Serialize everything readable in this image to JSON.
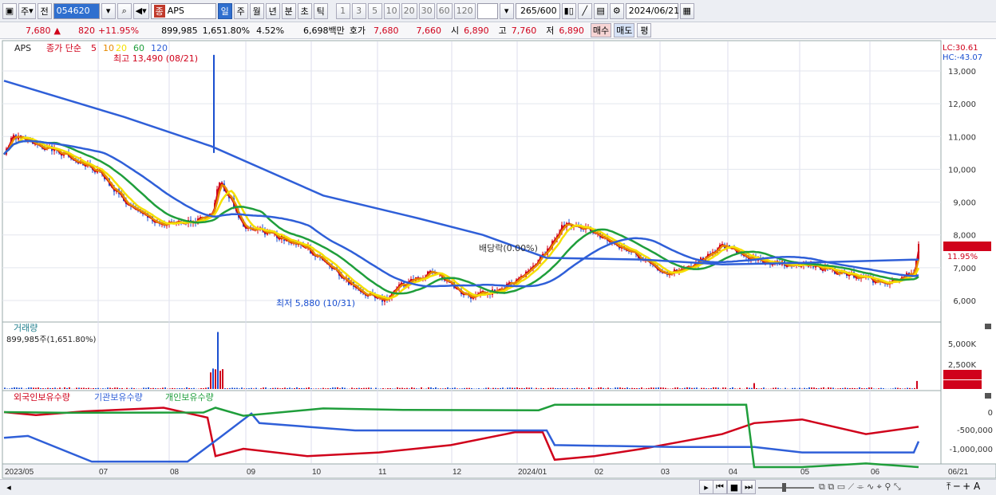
{
  "toolbar": {
    "market": "주",
    "prev": "전",
    "code": "054620",
    "stock_name": "APS",
    "hts": "종",
    "periods": [
      "일",
      "주",
      "월",
      "년",
      "분",
      "초",
      "틱"
    ],
    "active_period": "일",
    "counts": [
      "1",
      "3",
      "5",
      "10",
      "20",
      "30",
      "60",
      "120"
    ],
    "page": "265",
    "page_total": "/600",
    "date": "2024/06/21"
  },
  "quote": {
    "price": "7,680",
    "change": "820",
    "change_pct": "+11.95%",
    "volume": "899,985",
    "volume_pct": "1,651.80%",
    "turnover": "4.52%",
    "amount": "6,698백만",
    "bid_label": "호가",
    "ask": "7,680",
    "bid": "7,660",
    "open_label": "시",
    "open": "6,890",
    "high_label": "고",
    "high": "7,760",
    "low_label": "저",
    "low": "6,890",
    "buy": "매수",
    "sell": "매도",
    "avg": "평"
  },
  "price_panel": {
    "name": "APS",
    "legend_prefix": "종가 단순",
    "ma": [
      {
        "period": "5",
        "color": "#d0021b"
      },
      {
        "period": "10",
        "color": "#e68a00"
      },
      {
        "period": "20",
        "color": "#f5e000"
      },
      {
        "period": "60",
        "color": "#1f9e3b"
      },
      {
        "period": "120",
        "color": "#2f5fd8"
      }
    ],
    "lc": "LC:30.61",
    "hc": "HC:-43.07",
    "high_note": "최고 13,490 (08/21)",
    "low_note": "최저 5,880 (10/31)",
    "dividend": "배당락(0.00%)",
    "price_tag": "7,680",
    "pct_tag": "11.95%",
    "y_ticks": [
      "13,000",
      "12,000",
      "11,000",
      "10,000",
      "9,000",
      "8,000",
      "7,000",
      "6,000"
    ]
  },
  "volume_panel": {
    "title": "거래량",
    "value_text": "899,985주(1,651.80%)",
    "y_ticks": [
      "5,000K",
      "2,500K"
    ],
    "tag": "899,985",
    "tag2": "1651.80%"
  },
  "holdings_panel": {
    "labels": [
      "외국인보유수량",
      "기관보유수량",
      "개인보유수량"
    ],
    "colors": [
      "#d0021b",
      "#2f5fd8",
      "#1f9e3b"
    ],
    "y_ticks": [
      "0",
      "-500,000",
      "-1,000,000"
    ]
  },
  "x_ticks": [
    "2023/05",
    "07",
    "08",
    "09",
    "10",
    "11",
    "12",
    "2024/01",
    "02",
    "03",
    "04",
    "05",
    "06",
    "06/21"
  ]
}
